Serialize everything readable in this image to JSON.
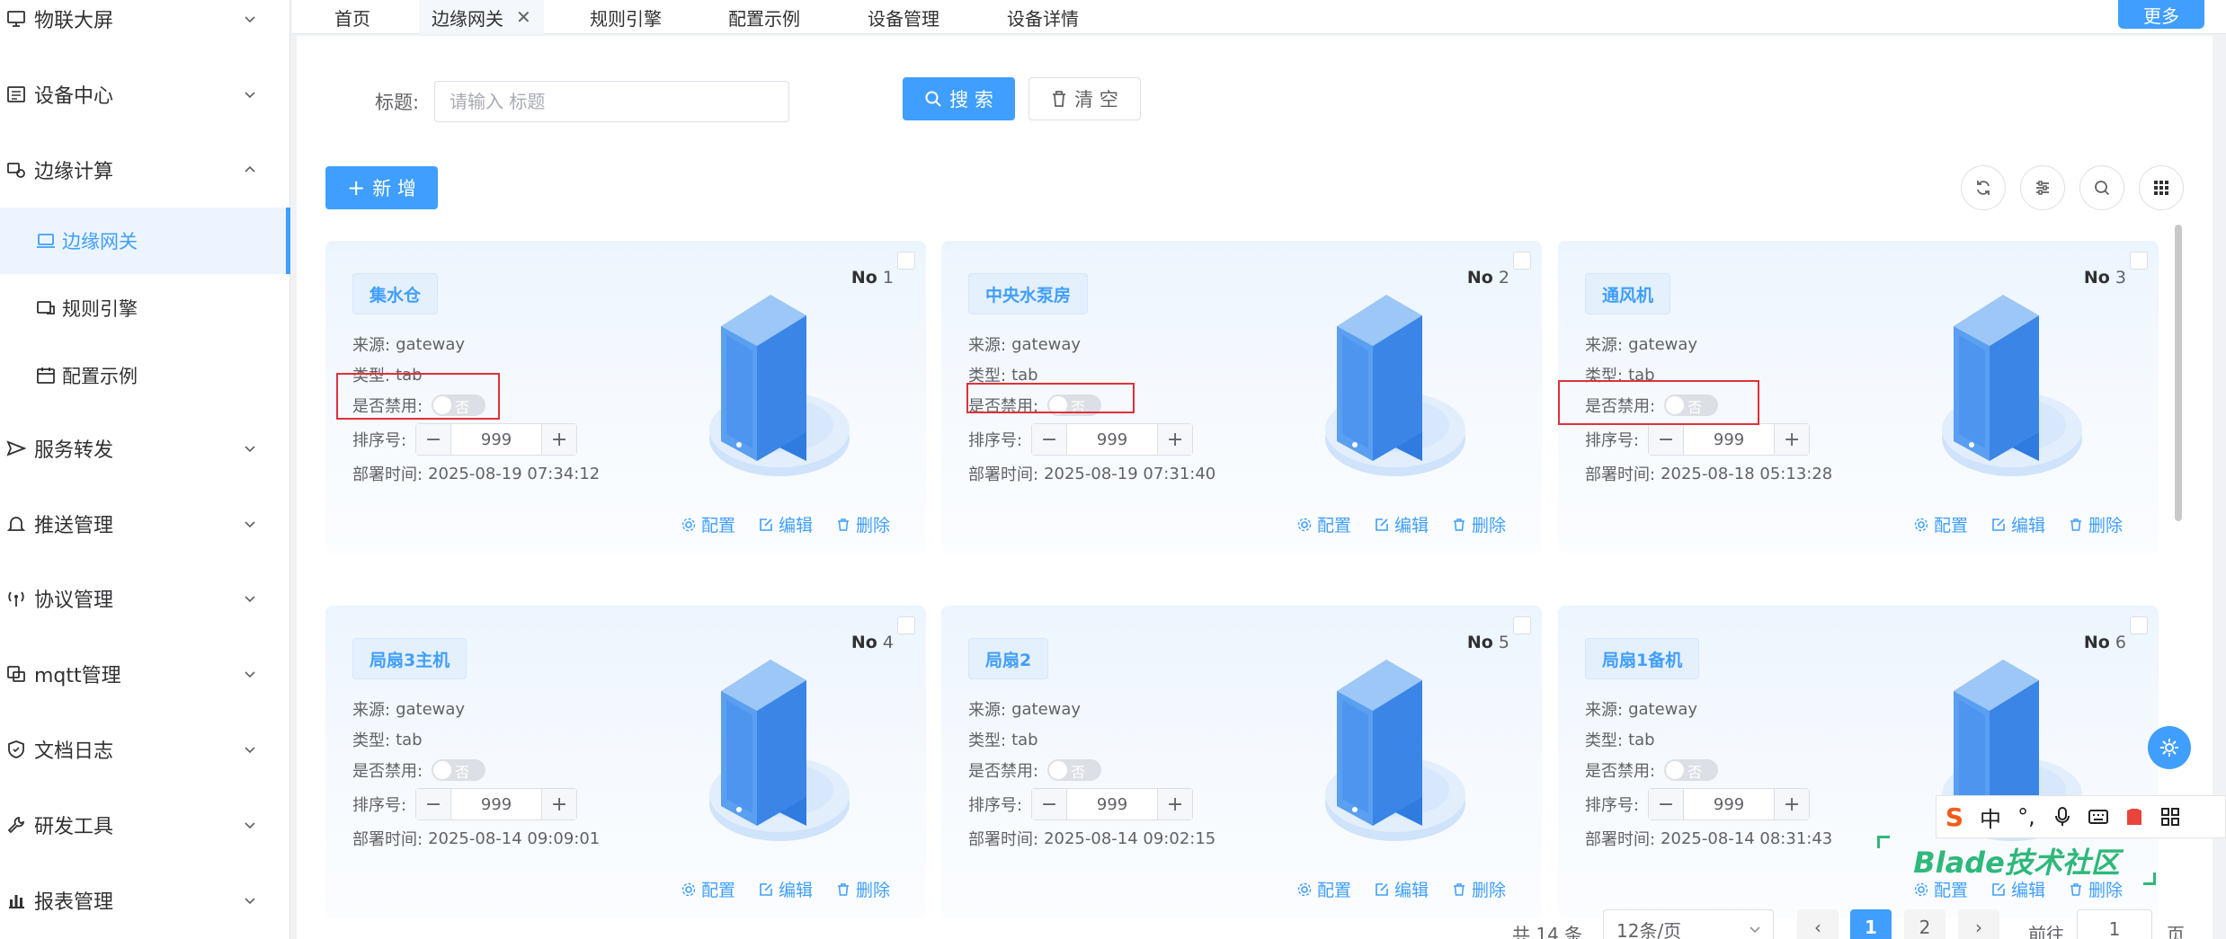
{
  "sidebar": {
    "items": [
      {
        "label": "物联大屏",
        "icon": "monitor-icon",
        "expanded": false
      },
      {
        "label": "设备中心",
        "icon": "device-icon",
        "expanded": false
      },
      {
        "label": "边缘计算",
        "icon": "edge-icon",
        "expanded": true
      },
      {
        "label": "服务转发",
        "icon": "send-icon",
        "expanded": false
      },
      {
        "label": "推送管理",
        "icon": "bell-icon",
        "expanded": false
      },
      {
        "label": "协议管理",
        "icon": "antenna-icon",
        "expanded": false
      },
      {
        "label": "mqtt管理",
        "icon": "mqtt-icon",
        "expanded": false
      },
      {
        "label": "文档日志",
        "icon": "shield-icon",
        "expanded": false
      },
      {
        "label": "研发工具",
        "icon": "wrench-icon",
        "expanded": false
      },
      {
        "label": "报表管理",
        "icon": "bar-chart-icon",
        "expanded": false
      }
    ],
    "sub_items": [
      {
        "label": "边缘网关",
        "icon": "laptop-icon",
        "active": true
      },
      {
        "label": "规则引擎",
        "icon": "engine-icon",
        "active": false
      },
      {
        "label": "配置示例",
        "icon": "calendar-icon",
        "active": false
      }
    ]
  },
  "tabs": [
    {
      "label": "首页",
      "active": false
    },
    {
      "label": "边缘网关",
      "active": true
    },
    {
      "label": "规则引擎",
      "active": false
    },
    {
      "label": "配置示例",
      "active": false
    },
    {
      "label": "设备管理",
      "active": false
    },
    {
      "label": "设备详情",
      "active": false
    }
  ],
  "more_label": "更多",
  "search": {
    "label": "标题:",
    "placeholder": "请输入 标题",
    "search_label": "搜 索",
    "clear_label": "清 空"
  },
  "add_label": "新 增",
  "card_fields": {
    "source": "来源:",
    "type": "类型:",
    "disabled": "是否禁用:",
    "sort": "排序号:",
    "deploy": "部署时间:",
    "no_prefix": "No",
    "switch_off_text": "否"
  },
  "card_actions": {
    "config": "配置",
    "edit": "编辑",
    "delete": "删除"
  },
  "cards": [
    {
      "no": "1",
      "title": "集水仓",
      "source": "gateway",
      "type": "tab",
      "sort": "999",
      "deploy_time": "2025-08-19 07:34:12"
    },
    {
      "no": "2",
      "title": "中央水泵房",
      "source": "gateway",
      "type": "tab",
      "sort": "999",
      "deploy_time": "2025-08-19 07:31:40"
    },
    {
      "no": "3",
      "title": "通风机",
      "source": "gateway",
      "type": "tab",
      "sort": "999",
      "deploy_time": "2025-08-18 05:13:28"
    },
    {
      "no": "4",
      "title": "局扇3主机",
      "source": "gateway",
      "type": "tab",
      "sort": "999",
      "deploy_time": "2025-08-14 09:09:01"
    },
    {
      "no": "5",
      "title": "局扇2",
      "source": "gateway",
      "type": "tab",
      "sort": "999",
      "deploy_time": "2025-08-14 09:02:15"
    },
    {
      "no": "6",
      "title": "局扇1备机",
      "source": "gateway",
      "type": "tab",
      "sort": "999",
      "deploy_time": "2025-08-14 08:31:43"
    }
  ],
  "pagination": {
    "total": "共 14 条",
    "page_size": "12条/页",
    "pages": [
      "1",
      "2"
    ],
    "current": "1",
    "goto_label": "前往",
    "goto_value": "1",
    "page_suffix": "页"
  },
  "ime": {
    "chinese": "中",
    "punct": "°,"
  },
  "watermark": "Blade技术社区",
  "colors": {
    "primary": "#409eff",
    "highlight_box": "#e0303a",
    "watermark": "#2fb87a"
  }
}
